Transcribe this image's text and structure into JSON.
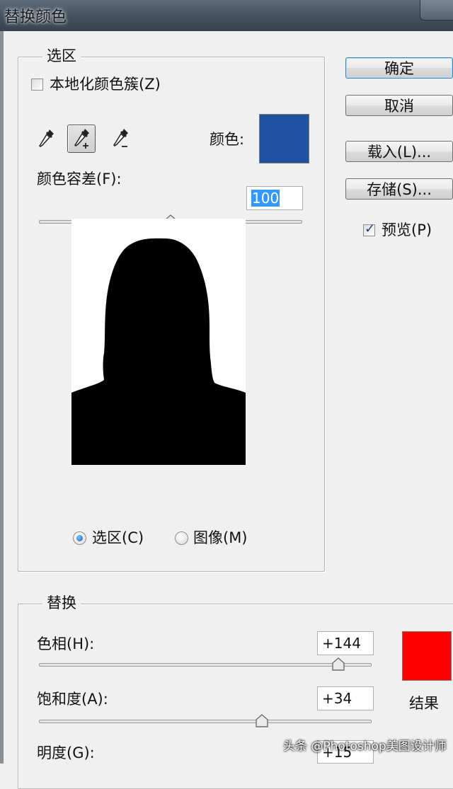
{
  "window": {
    "title": "替换颜色"
  },
  "buttons": {
    "ok": "确定",
    "cancel": "取消",
    "load": "载入(L)...",
    "save": "存储(S)..."
  },
  "preview": {
    "label": "预览(P)",
    "checked": true
  },
  "selection": {
    "legend": "选区",
    "localized_label": "本地化颜色簇(Z)",
    "localized_checked": false,
    "tools": [
      "eyedropper-icon",
      "eyedropper-plus-icon",
      "eyedropper-minus-icon"
    ],
    "active_tool": "eyedropper-plus-icon",
    "color_label": "颜色:",
    "color": "#1f52a0",
    "fuzziness_label": "颜色容差(F):",
    "fuzziness_value": "100",
    "fuzziness_level": 0.5,
    "radio_selection": "选区(C)",
    "radio_image": "图像(M)",
    "selected_radio": "选区(C)"
  },
  "replace": {
    "legend": "替换",
    "hue_label": "色相(H):",
    "hue_value": "+144",
    "hue_level": 0.9,
    "saturation_label": "饱和度(A):",
    "saturation_value": "+34",
    "saturation_level": 0.67,
    "lightness_label": "明度(G):",
    "lightness_value": "+15",
    "result_label": "结果",
    "result_color": "#ff0000"
  },
  "watermark": "头条 @Photoshop美图设计师"
}
